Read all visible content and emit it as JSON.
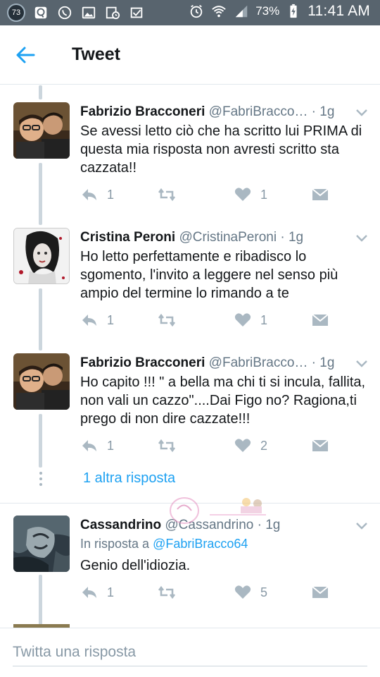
{
  "status_bar": {
    "notification_count": "73",
    "battery_percent": "73%",
    "time": "11:41 AM"
  },
  "header": {
    "title": "Tweet"
  },
  "tweets": [
    {
      "name": "Fabrizio Bracconeri",
      "handle": "@FabriBracco…",
      "time": "· 1g",
      "text": "Se avessi letto ciò che ha scritto lui PRIMA di questa mia risposta non avresti scritto sta cazzata!!",
      "replies": "1",
      "likes": "1"
    },
    {
      "name": "Cristina Peroni",
      "handle": "@CristinaPeroni",
      "time": "· 1g",
      "text": "Ho letto perfettamente e ribadisco lo sgomento, l'invito a leggere nel senso più ampio del termine lo rimando a te",
      "replies": "1",
      "likes": "1"
    },
    {
      "name": "Fabrizio Bracconeri",
      "handle": "@FabriBracco…",
      "time": "· 1g",
      "text": "Ho capito !!!  \" a bella ma chi ti si incula, fallita, non vali un cazzo\"....Dai Figo no? Ragiona,ti prego di non dire cazzate!!!",
      "replies": "1",
      "likes": "2"
    },
    {
      "name": "Cassandrino",
      "handle": "@Cassandrino",
      "time": "· 1g",
      "reply_prefix": "In risposta a ",
      "reply_to": "@FabriBracco64",
      "text": "Genio dell'idiozia.",
      "replies": "1",
      "likes": "5"
    }
  ],
  "more_replies": "1 altra risposta",
  "composer": {
    "placeholder": "Twitta una risposta"
  },
  "colors": {
    "accent": "#1da1f2",
    "status_bar": "#58646e",
    "muted": "#657786",
    "icon_gray": "#8899a6"
  }
}
